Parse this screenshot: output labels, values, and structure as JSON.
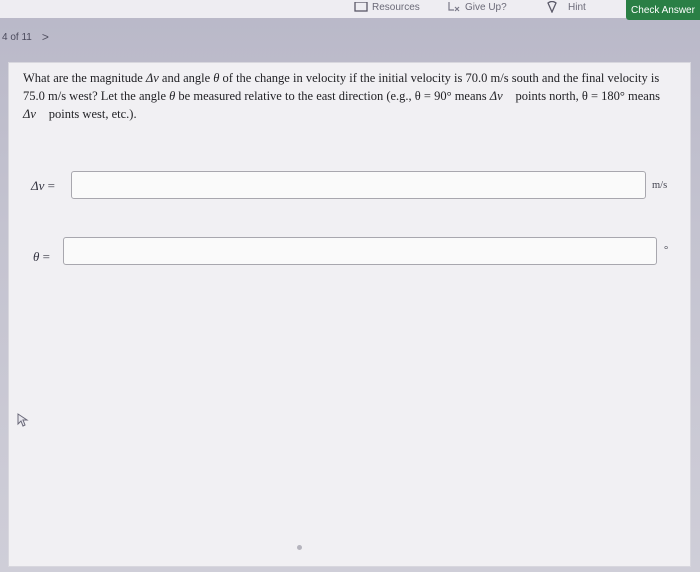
{
  "toolbar": {
    "resources_label": "Resources",
    "giveup_label": "Give Up?",
    "hint_label": "Hint",
    "check_label": "Check Answer"
  },
  "pager": {
    "position": "4 of 11",
    "next_glyph": ">"
  },
  "question": {
    "part1": "What are the magnitude ",
    "dv": "Δv",
    "part2": " and angle ",
    "theta": "θ",
    "part3": " of the change in velocity if the initial velocity is 70.0 m/s south and the final velocity is 75.0 m/s west? Let the angle ",
    "theta2": "θ",
    "part4": " be measured relative to the east direction (e.g., ",
    "ex1": "θ = 90°",
    "part5": " means ",
    "dvvec1": "Δv⃗",
    "part6": " points north, ",
    "ex2": "θ = 180°",
    "part7": " means ",
    "dvvec2": "Δv⃗",
    "part8": " points west, etc.)."
  },
  "fields": {
    "dv_label": "Δv",
    "dv_eq": " =",
    "dv_value": "",
    "dv_unit": "m/s",
    "theta_label": "θ",
    "theta_eq": " =",
    "theta_value": "",
    "theta_unit": "°"
  },
  "colors": {
    "check_button": "#2a7f45",
    "background": "#c4c3d0",
    "card": "#f1f0f3"
  },
  "icons": {
    "resources": "resources-icon",
    "giveup": "giveup-icon",
    "hint": "hint-icon",
    "cursor": "mouse-pointer-icon"
  }
}
